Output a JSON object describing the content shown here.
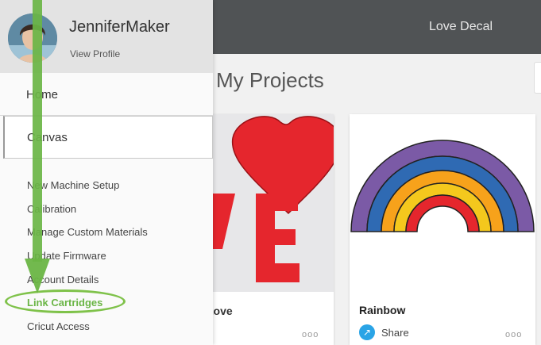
{
  "app": {
    "project_title": "Love Decal",
    "page_heading": "My Projects"
  },
  "drawer": {
    "username": "JenniferMaker",
    "view_profile": "View Profile",
    "nav": {
      "home": "Home",
      "canvas": "Canvas"
    },
    "menu_items": [
      "New Machine Setup",
      "Calibration",
      "Manage Custom Materials",
      "Update Firmware",
      "Account Details",
      "Link Cartridges",
      "Cricut Access"
    ]
  },
  "projects": [
    {
      "title": "Love",
      "more": "ooo"
    },
    {
      "title": "Rainbow",
      "share_label": "Share",
      "more": "ooo"
    }
  ],
  "colors": {
    "topbar": "#505355",
    "highlight_green": "#7fc24a",
    "arrow_green": "#6ab545",
    "share_blue": "#2aa4e6",
    "heart_red": "#e5262d",
    "rainbow": [
      "#7b5aa6",
      "#2f6ab3",
      "#f7a21b",
      "#f4c81d",
      "#e5262d"
    ]
  },
  "icons": {
    "share": "share-arrow-icon",
    "more": "more-options-icon",
    "annotation_arrow": "down-arrow-annotation"
  }
}
